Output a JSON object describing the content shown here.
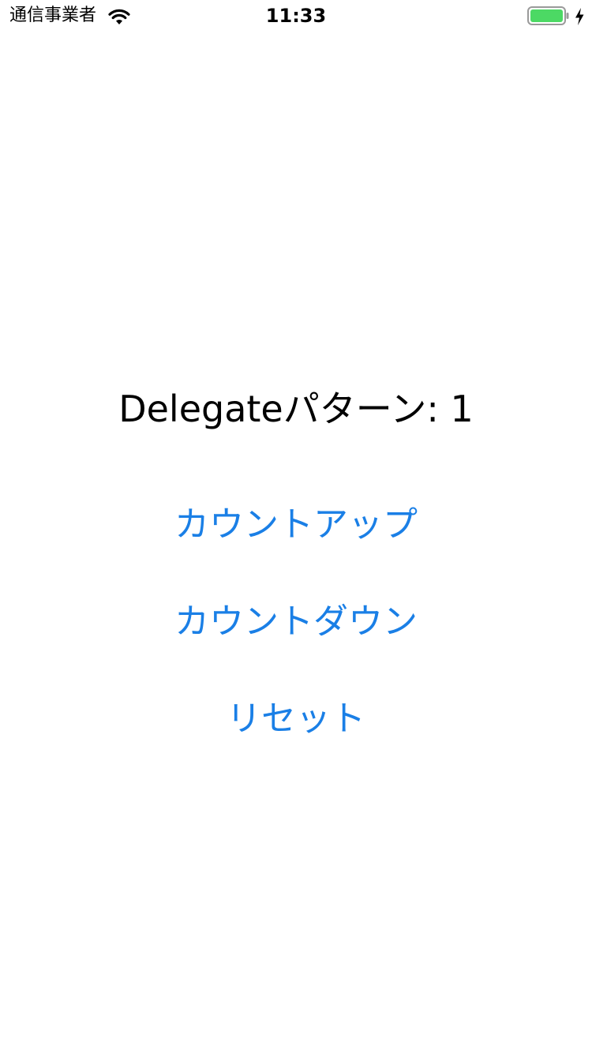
{
  "status_bar": {
    "carrier": "通信事業者",
    "time": "11:33",
    "wifi_icon": "wifi-icon",
    "battery_icon": "battery-icon",
    "charging_icon": "charging-bolt-icon",
    "battery_level": 1.0,
    "battery_color": "#4cd964"
  },
  "main": {
    "counter_text": "Delegateパターン: 1",
    "buttons": {
      "count_up": "カウントアップ",
      "count_down": "カウントダウン",
      "reset": "リセット"
    }
  },
  "colors": {
    "accent": "#1a7fe6",
    "text": "#000000",
    "background": "#ffffff"
  }
}
